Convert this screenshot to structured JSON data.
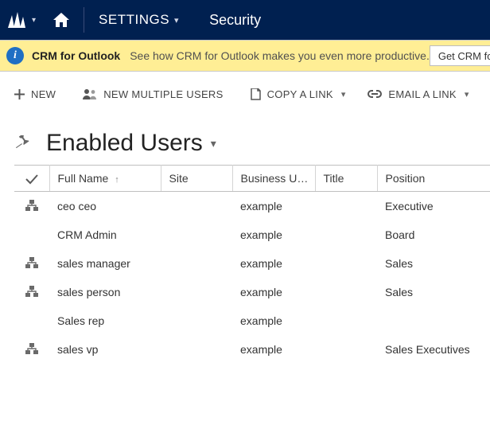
{
  "topbar": {
    "menu_label": "SETTINGS",
    "page_label": "Security"
  },
  "notice": {
    "title": "CRM for Outlook",
    "text": "See how CRM for Outlook makes you even more productive.",
    "button": "Get CRM for"
  },
  "commands": {
    "new": "NEW",
    "new_multiple": "NEW MULTIPLE USERS",
    "copy_link": "COPY A LINK",
    "email_link": "EMAIL A LINK"
  },
  "view": {
    "title": "Enabled Users"
  },
  "columns": {
    "full_name": "Full Name",
    "site": "Site",
    "business_unit": "Business Unit...",
    "title": "Title",
    "position": "Position"
  },
  "rows": [
    {
      "has_hier": true,
      "full_name": "ceo ceo",
      "site": "",
      "business_unit": "example",
      "title": "",
      "position": "Executive"
    },
    {
      "has_hier": false,
      "full_name": "CRM Admin",
      "site": "",
      "business_unit": "example",
      "title": "",
      "position": "Board"
    },
    {
      "has_hier": true,
      "full_name": "sales manager",
      "site": "",
      "business_unit": "example",
      "title": "",
      "position": "Sales"
    },
    {
      "has_hier": true,
      "full_name": "sales person",
      "site": "",
      "business_unit": "example",
      "title": "",
      "position": "Sales"
    },
    {
      "has_hier": false,
      "full_name": "Sales rep",
      "site": "",
      "business_unit": "example",
      "title": "",
      "position": ""
    },
    {
      "has_hier": true,
      "full_name": "sales vp",
      "site": "",
      "business_unit": "example",
      "title": "",
      "position": "Sales Executives"
    }
  ]
}
